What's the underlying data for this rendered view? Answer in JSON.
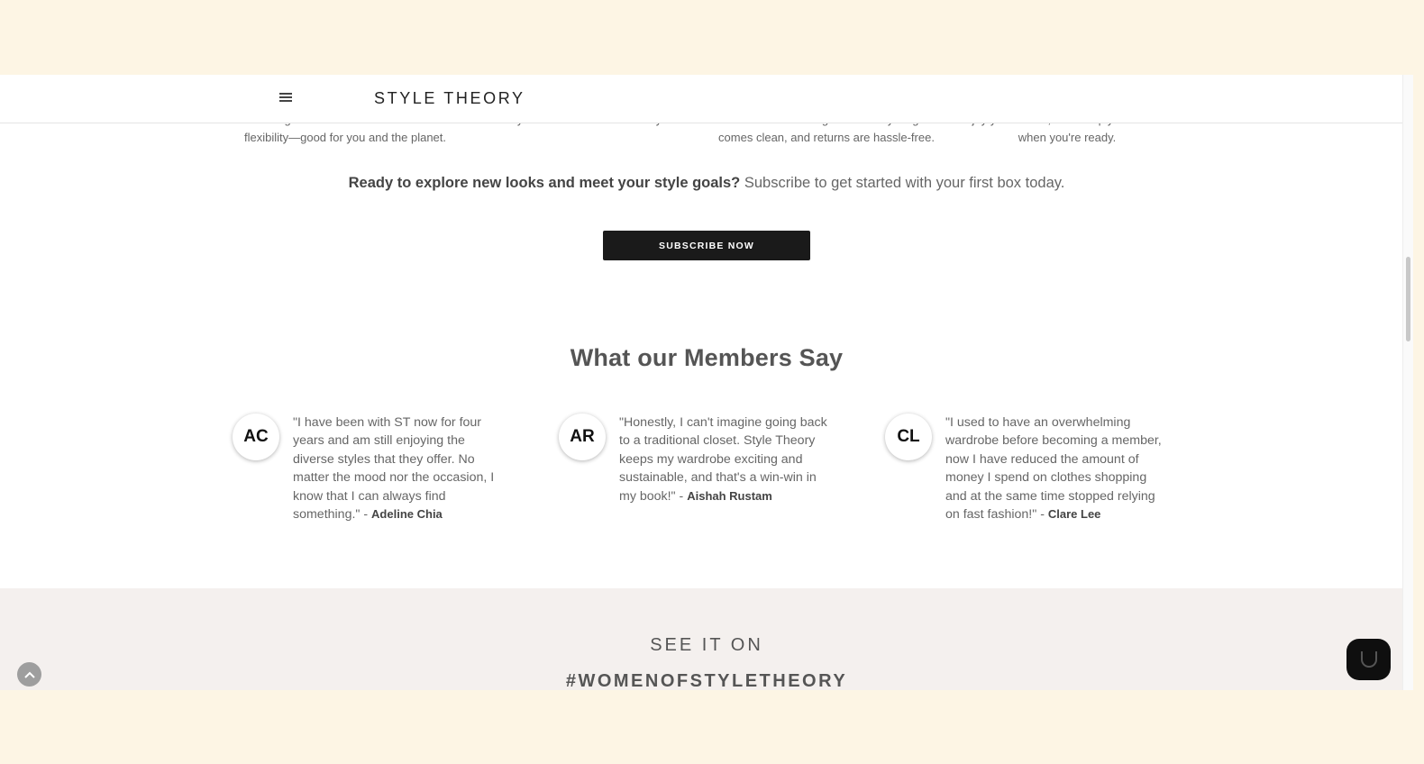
{
  "header": {
    "logo": "STYLE THEORY",
    "menu_icon": "hamburger-menu-icon"
  },
  "features": [
    {
      "line1": "Renting means less waste and more",
      "line2": "flexibility—good for you and the planet."
    },
    {
      "line1": "Refresh your wardrobe as often as you like.",
      "line2": ""
    },
    {
      "line1": "We handle the logistics - everything",
      "line2": "comes clean, and returns are hassle-free."
    },
    {
      "line1": "Enjoy your outfits, then simply return them",
      "line2": "when you're ready."
    }
  ],
  "cta": {
    "bold": "Ready to explore new looks and meet your style goals?",
    "rest": " Subscribe to get started with your first box today.",
    "button": "SUBSCRIBE NOW"
  },
  "testimonials": {
    "title": "What our Members Say",
    "items": [
      {
        "initials": "AC",
        "quote": "\"I have been with ST now for four years and am still enjoying the diverse styles that they offer. No matter the mood nor the occasion, I know that I can always find something.\" - ",
        "author": "Adeline Chia"
      },
      {
        "initials": "AR",
        "quote": "\"Honestly, I can't imagine going back to a traditional closet. Style Theory keeps my wardrobe exciting and sustainable, and that's a win-win in my book!\" - ",
        "author": "Aishah Rustam"
      },
      {
        "initials": "CL",
        "quote": "\"I used to have an overwhelming wardrobe before becoming a member, now I have reduced the amount of money I spend on clothes shopping and at the same time stopped relying on fast fashion!\" - ",
        "author": "Clare Lee"
      }
    ]
  },
  "see_it_on": {
    "title": "SEE IT ON",
    "hashtag": "#WOMENOFSTYLETHEORY"
  },
  "floating": {
    "back_to_top_icon": "chevron-up-icon",
    "chat_icon": "chat-icon"
  },
  "colors": {
    "band": "#fdf5e4",
    "button_bg": "#1a1a1a",
    "section_bg": "#f4f0ee"
  }
}
